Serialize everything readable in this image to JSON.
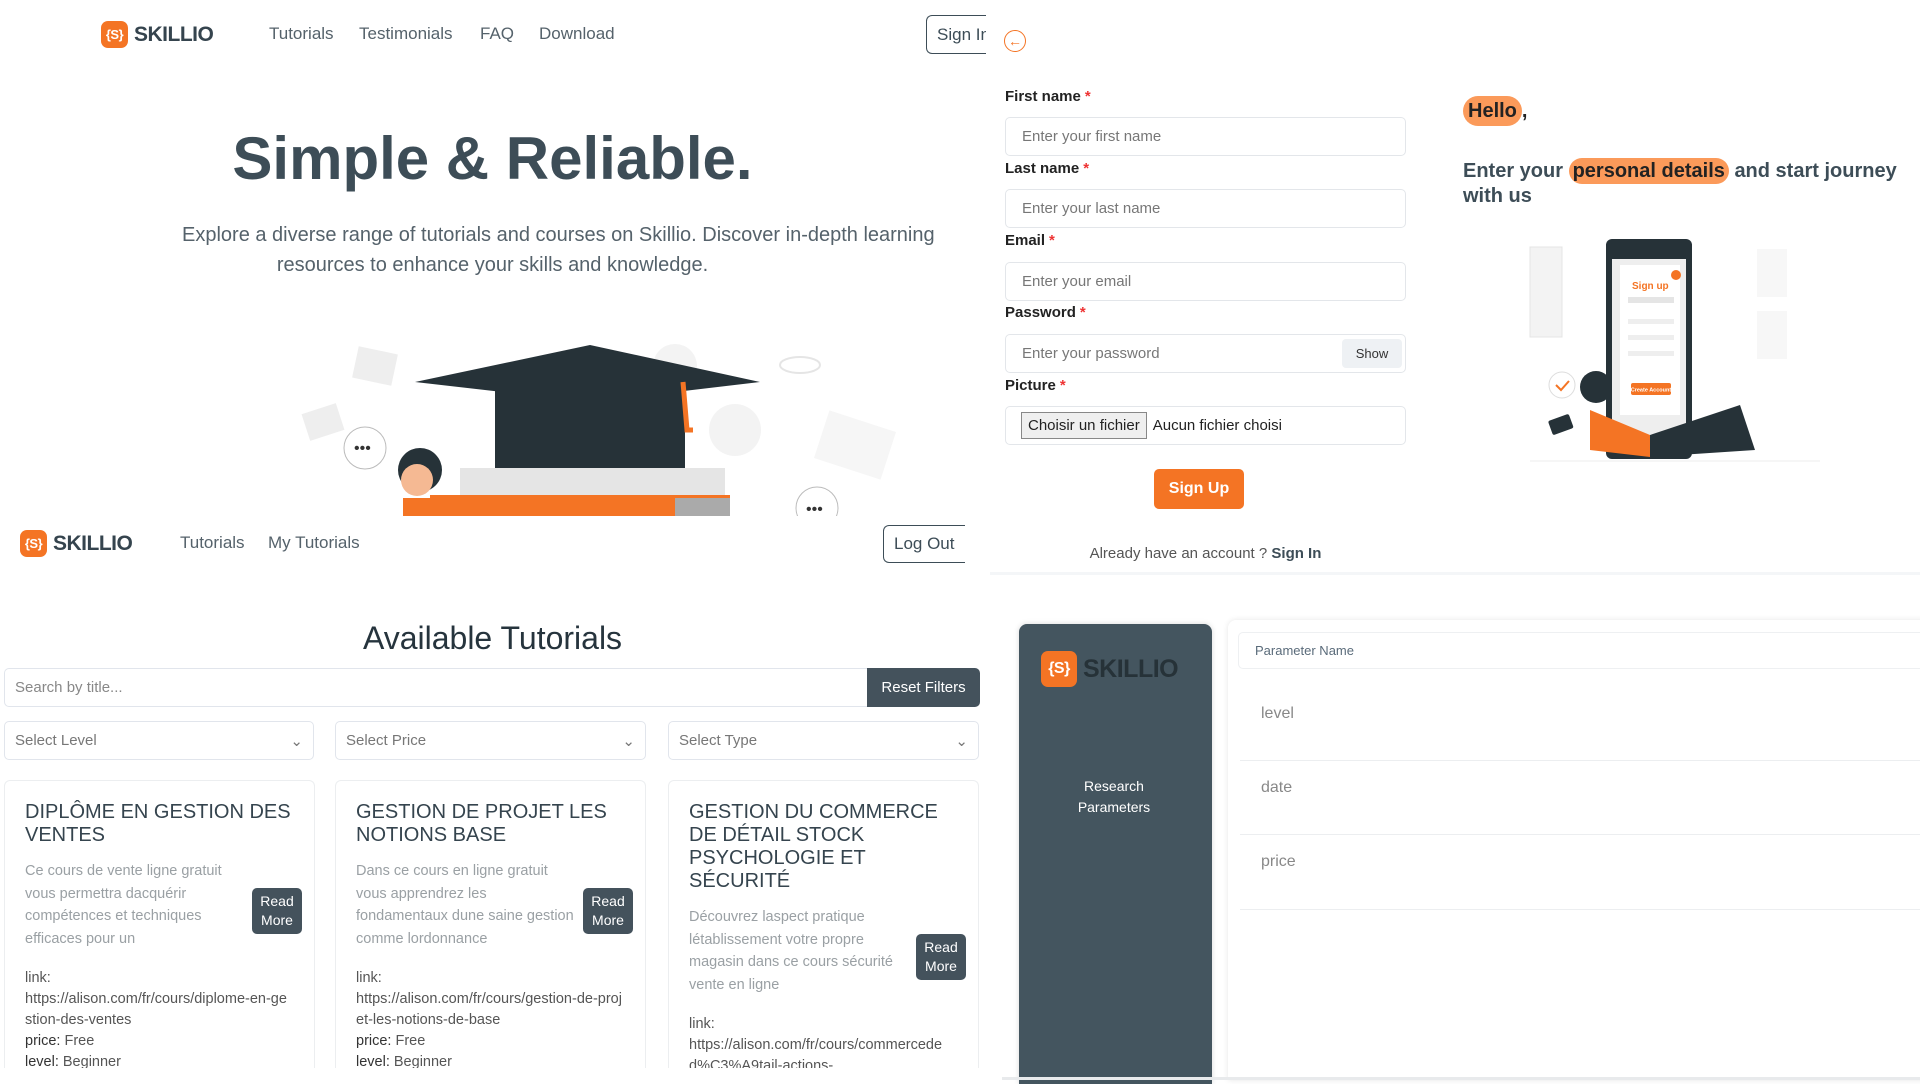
{
  "brand": {
    "logo_mark": "{S}",
    "name": "SKILLIO",
    "accent": "#f47424",
    "dark": "#44525c"
  },
  "landing": {
    "nav": [
      "Tutorials",
      "Testimonials",
      "FAQ",
      "Download"
    ],
    "sign_in": "Sign In",
    "title": "Simple & Reliable.",
    "subtitle_1": "Explore a diverse range of tutorials and courses on Skillio. Discover in-depth learning",
    "subtitle_2": "resources to enhance your skills and knowledge."
  },
  "signup": {
    "fields": [
      {
        "label": "First name",
        "placeholder": "Enter your first name"
      },
      {
        "label": "Last name",
        "placeholder": "Enter your last name"
      },
      {
        "label": "Email",
        "placeholder": "Enter your email"
      },
      {
        "label": "Password",
        "placeholder": "Enter your password"
      },
      {
        "label": "Picture"
      }
    ],
    "required_mark": "*",
    "show": "Show",
    "file_button": "Choisir un fichier",
    "file_status": "Aucun fichier choisi",
    "submit": "Sign Up",
    "already": "Already have an account ?",
    "sign_in": "Sign In",
    "hello": "Hello",
    "comma": ",",
    "tag_1": "Enter your",
    "tag_highlight": "personal details",
    "tag_2": "and start journey with us",
    "illustration_title": "Sign up",
    "illustration_button": "Create Account"
  },
  "tutorials": {
    "nav": [
      "Tutorials",
      "My Tutorials"
    ],
    "logout": "Log Out",
    "heading": "Available Tutorials",
    "search_placeholder": "Search by title...",
    "reset": "Reset Filters",
    "filters": [
      "Select Level",
      "Select Price",
      "Select Type"
    ],
    "cards": [
      {
        "title": "Diplôme en gestion des ventes",
        "desc": "Ce cours de vente ligne gratuit vous permettra dacquérir compétences et techniques efficaces pour un",
        "link": "https://alison.com/fr/cours/diplome-en-gestion-des-ventes",
        "price": "Free",
        "level": "Beginner"
      },
      {
        "title": "Gestion de projet les notions base",
        "desc": "Dans ce cours en ligne gratuit vous apprendrez les fondamentaux dune saine gestion comme lordonnance",
        "link": "https://alison.com/fr/cours/gestion-de-projet-les-notions-de-base",
        "price": "Free",
        "level": "Beginner"
      },
      {
        "title": "Gestion du commerce de détail stock psychologie et sécurité",
        "desc": "Découvrez laspect pratique létablissement votre propre magasin dans ce cours sécurité vente en ligne",
        "link": "https://alison.com/fr/cours/commerceded%C3%A9tail-actions-"
      }
    ],
    "read_more": "Read More",
    "link_label": "link:",
    "price_label": "price:",
    "level_label": "level:"
  },
  "admin": {
    "sidebar_item": "Research Parameters",
    "column": "Parameter Name",
    "rows": [
      "level",
      "date",
      "price"
    ]
  }
}
